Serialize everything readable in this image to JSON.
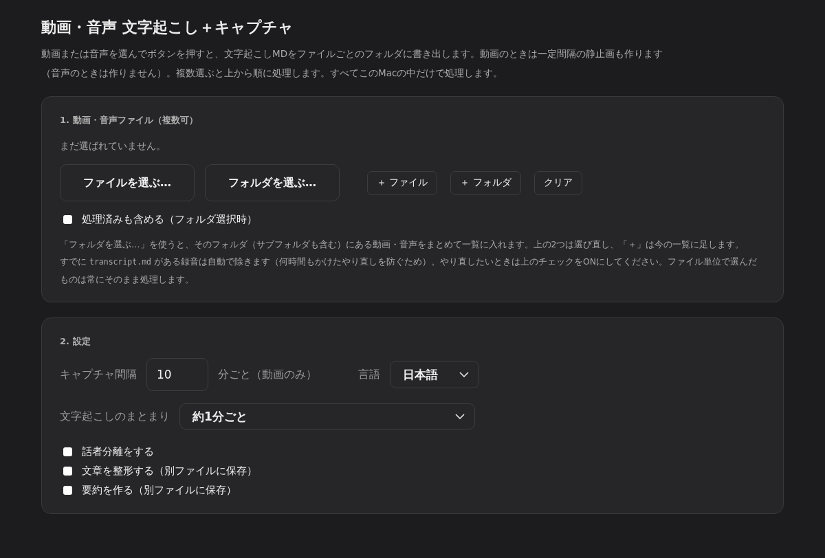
{
  "title": "動画・音声 文字起こし＋キャプチャ",
  "description": [
    "動画または音声を選んでボタンを押すと、文字起こしMDをファイルごとのフォルダに書き出します。動画のときは一定間隔の静止画も作ります",
    "（音声のときは作りません）。複数選ぶと上から順に処理します。すべてこのMacの中だけで処理します。"
  ],
  "files_section": {
    "heading": "1. 動画・音声ファイル（複数可）",
    "empty_message": "まだ選ばれていません。",
    "buttons": [
      {
        "label": "ファイルを選ぶ…",
        "kind": "primary"
      },
      {
        "label": "フォルダを選ぶ…",
        "kind": "primary"
      },
      {
        "label": "＋ ファイル",
        "kind": "small"
      },
      {
        "label": "＋ フォルダ",
        "kind": "small"
      },
      {
        "label": "クリア",
        "kind": "small"
      }
    ],
    "include_processed": {
      "label": "処理済みも含める（フォルダ選択時）",
      "checked": false
    },
    "help": [
      {
        "text_before": "「フォルダを選ぶ…」を使うと、そのフォルダ（サブフォルダも含む）にある動画・音声をまとめて一覧に入れます。上の2つは選び直し、「＋」は今の一覧に足します。"
      },
      {
        "text_before": "すでに ",
        "code": "transcript.md",
        "text_after": " がある録音は自動で除きます（何時間もかけたやり直しを防ぐため）。やり直したいときは上のチェックをONにしてください。ファイル単位で選んだものは常にそのまま処理します。"
      }
    ]
  },
  "settings_section": {
    "heading": "2. 設定",
    "capture_interval": {
      "label": "キャプチャ間隔",
      "value": "10",
      "unit": "分ごと（動画のみ）"
    },
    "language": {
      "label": "言語",
      "value": "日本語"
    },
    "grouping": {
      "label": "文字起こしのまとまり",
      "value": "約1分ごと"
    },
    "options": [
      {
        "label": "話者分離をする",
        "checked": false
      },
      {
        "label": "文章を整形する（別ファイルに保存）",
        "checked": false
      },
      {
        "label": "要約を作る（別ファイルに保存）",
        "checked": false
      }
    ]
  }
}
